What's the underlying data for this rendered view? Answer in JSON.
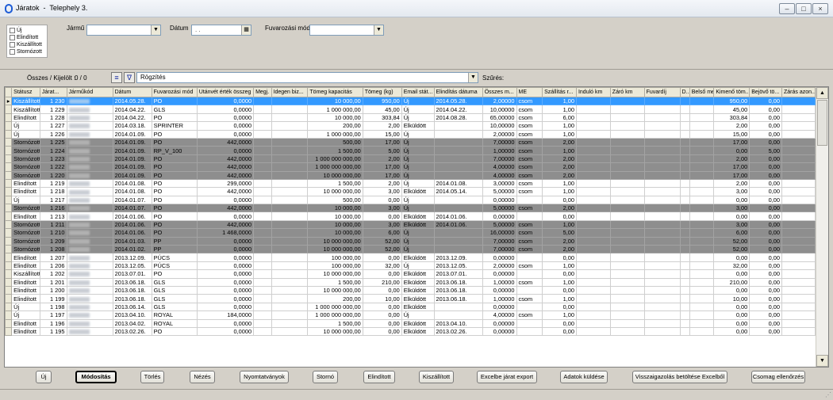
{
  "window": {
    "title": "Járatok  -  Telephely 3."
  },
  "filters": {
    "status_options": [
      "Új",
      "Elindított",
      "Kiszállított",
      "Stornózott"
    ],
    "jarmu_label": "Jármű",
    "datum_label": "Dátum",
    "datum_value": ". .",
    "fuvarozasi_mod_label": "Fuvarozási mód"
  },
  "info_bar": {
    "osszes_label": "Összes / Kijelölt :",
    "osszes_value": "0 / 0",
    "rogzites_value": "Rögzítés",
    "szures_label": "Szűrés:"
  },
  "table": {
    "columns": [
      "Státusz",
      "Járat...",
      "Járműkód",
      "Dátum",
      "Fuvarozási mód",
      "Utánvét érték összeg",
      "Megj.",
      "Idegen biz...",
      "Tömeg kapacitás",
      "Tömeg (kg)",
      "Email stát...",
      "Elindítás dátuma",
      "Összes m...",
      "ME",
      "Szállítás r...",
      "Induló km",
      "Záró km",
      "Fuvardíj",
      "D...",
      "Belső me...",
      "Kimenő töm...",
      "Bejövő tö...",
      "Zárás azon..."
    ],
    "rows": [
      {
        "status": "Kiszállított",
        "jarat": "1 230",
        "datum": "2014.05.28.",
        "mod": "PO",
        "utanvet": "0,0000",
        "kapacitas": "10 000,00",
        "tomeg": "950,00",
        "email": "Új",
        "elindit": "2014.05.28.",
        "osszes": "2,00000",
        "me": "csom",
        "szall": "1,00",
        "kimeno": "950,00",
        "bejovo": "0,00",
        "hl": "selected"
      },
      {
        "status": "Kiszállított",
        "jarat": "1 229",
        "datum": "2014.04.22.",
        "mod": "GLS",
        "utanvet": "0,0000",
        "kapacitas": "1 000 000,00",
        "tomeg": "45,00",
        "email": "Új",
        "elindit": "2014.04.22.",
        "osszes": "10,00000",
        "me": "csom",
        "szall": "1,00",
        "kimeno": "45,00",
        "bejovo": "0,00",
        "hl": ""
      },
      {
        "status": "Elindított",
        "jarat": "1 228",
        "datum": "2014.04.22.",
        "mod": "PO",
        "utanvet": "0,0000",
        "kapacitas": "10 000,00",
        "tomeg": "303,84",
        "email": "Új",
        "elindit": "2014.08.28.",
        "osszes": "65,00000",
        "me": "csom",
        "szall": "6,00",
        "kimeno": "303,84",
        "bejovo": "0,00",
        "hl": ""
      },
      {
        "status": "Új",
        "jarat": "1 227",
        "datum": "2014.03.18.",
        "mod": "SPRINTER",
        "utanvet": "0,0000",
        "kapacitas": "200,00",
        "tomeg": "2,00",
        "email": "Elküldött",
        "elindit": "",
        "osszes": "10,00000",
        "me": "csom",
        "szall": "1,00",
        "kimeno": "2,00",
        "bejovo": "0,00",
        "hl": ""
      },
      {
        "status": "Új",
        "jarat": "1 226",
        "datum": "2014.01.09.",
        "mod": "PO",
        "utanvet": "0,0000",
        "kapacitas": "1 000 000,00",
        "tomeg": "15,00",
        "email": "Új",
        "elindit": "",
        "osszes": "2,00000",
        "me": "csom",
        "szall": "1,00",
        "kimeno": "15,00",
        "bejovo": "0,00",
        "hl": ""
      },
      {
        "status": "Stornózott",
        "jarat": "1 225",
        "datum": "2014.01.09.",
        "mod": "PO",
        "utanvet": "442,0000",
        "kapacitas": "500,00",
        "tomeg": "17,00",
        "email": "Új",
        "elindit": "",
        "osszes": "7,00000",
        "me": "csom",
        "szall": "2,00",
        "kimeno": "17,00",
        "bejovo": "0,00",
        "hl": "storno"
      },
      {
        "status": "Stornózott",
        "jarat": "1 224",
        "datum": "2014.01.09.",
        "mod": "RP_V_100",
        "utanvet": "0,0000",
        "kapacitas": "1 500,00",
        "tomeg": "5,00",
        "email": "Új",
        "elindit": "",
        "osszes": "1,00000",
        "me": "csom",
        "szall": "1,00",
        "kimeno": "0,00",
        "bejovo": "5,00",
        "hl": "storno"
      },
      {
        "status": "Stornózott",
        "jarat": "1 223",
        "datum": "2014.01.09.",
        "mod": "PO",
        "utanvet": "442,0000",
        "kapacitas": "1 000 000 000,00",
        "tomeg": "2,00",
        "email": "Új",
        "elindit": "",
        "osszes": "7,00000",
        "me": "csom",
        "szall": "2,00",
        "kimeno": "2,00",
        "bejovo": "0,00",
        "hl": "storno"
      },
      {
        "status": "Stornózott",
        "jarat": "1 222",
        "datum": "2014.01.09.",
        "mod": "PO",
        "utanvet": "442,0000",
        "kapacitas": "1 000 000 000,00",
        "tomeg": "17,00",
        "email": "Új",
        "elindit": "",
        "osszes": "4,00000",
        "me": "csom",
        "szall": "2,00",
        "kimeno": "17,00",
        "bejovo": "0,00",
        "hl": "storno"
      },
      {
        "status": "Stornózott",
        "jarat": "1 220",
        "datum": "2014.01.09.",
        "mod": "PO",
        "utanvet": "442,0000",
        "kapacitas": "10 000 000,00",
        "tomeg": "17,00",
        "email": "Új",
        "elindit": "",
        "osszes": "4,00000",
        "me": "csom",
        "szall": "2,00",
        "kimeno": "17,00",
        "bejovo": "0,00",
        "hl": "storno"
      },
      {
        "status": "Elindított",
        "jarat": "1 219",
        "datum": "2014.01.08.",
        "mod": "PO",
        "utanvet": "299,0000",
        "kapacitas": "1 500,00",
        "tomeg": "2,00",
        "email": "Új",
        "elindit": "2014.01.08.",
        "osszes": "3,00000",
        "me": "csom",
        "szall": "1,00",
        "kimeno": "2,00",
        "bejovo": "0,00",
        "hl": ""
      },
      {
        "status": "Elindított",
        "jarat": "1 218",
        "datum": "2014.01.08.",
        "mod": "PO",
        "utanvet": "442,0000",
        "kapacitas": "10 000 000,00",
        "tomeg": "3,00",
        "email": "Elküldött",
        "elindit": "2014.05.14.",
        "osszes": "5,00000",
        "me": "csom",
        "szall": "1,00",
        "kimeno": "3,00",
        "bejovo": "0,00",
        "hl": ""
      },
      {
        "status": "Új",
        "jarat": "1 217",
        "datum": "2014.01.07.",
        "mod": "PO",
        "utanvet": "0,0000",
        "kapacitas": "500,00",
        "tomeg": "0,00",
        "email": "Új",
        "elindit": "",
        "osszes": "0,00000",
        "me": "",
        "szall": "0,00",
        "kimeno": "0,00",
        "bejovo": "0,00",
        "hl": ""
      },
      {
        "status": "Stornózott",
        "jarat": "1 216",
        "datum": "2014.01.07.",
        "mod": "PO",
        "utanvet": "442,0000",
        "kapacitas": "10 000,00",
        "tomeg": "3,00",
        "email": "Új",
        "elindit": "",
        "osszes": "5,00000",
        "me": "csom",
        "szall": "2,00",
        "kimeno": "3,00",
        "bejovo": "0,00",
        "hl": "storno"
      },
      {
        "status": "Elindított",
        "jarat": "1 213",
        "datum": "2014.01.06.",
        "mod": "PO",
        "utanvet": "0,0000",
        "kapacitas": "10 000,00",
        "tomeg": "0,00",
        "email": "Elküldött",
        "elindit": "2014.01.06.",
        "osszes": "0,00000",
        "me": "",
        "szall": "0,00",
        "kimeno": "0,00",
        "bejovo": "0,00",
        "hl": ""
      },
      {
        "status": "Stornózott",
        "jarat": "1 211",
        "datum": "2014.01.06.",
        "mod": "PO",
        "utanvet": "442,0000",
        "kapacitas": "10 000,00",
        "tomeg": "3,00",
        "email": "Elküldött",
        "elindit": "2014.01.06.",
        "osszes": "5,00000",
        "me": "csom",
        "szall": "1,00",
        "kimeno": "3,00",
        "bejovo": "0,00",
        "hl": "storno"
      },
      {
        "status": "Stornózott",
        "jarat": "1 210",
        "datum": "2014.01.06.",
        "mod": "PO",
        "utanvet": "1 468,0000",
        "kapacitas": "10 000,00",
        "tomeg": "6,00",
        "email": "Új",
        "elindit": "",
        "osszes": "16,00000",
        "me": "csom",
        "szall": "5,00",
        "kimeno": "6,00",
        "bejovo": "0,00",
        "hl": "storno"
      },
      {
        "status": "Stornózott",
        "jarat": "1 209",
        "datum": "2014.01.03.",
        "mod": "PP",
        "utanvet": "0,0000",
        "kapacitas": "10 000 000,00",
        "tomeg": "52,00",
        "email": "Új",
        "elindit": "",
        "osszes": "7,00000",
        "me": "csom",
        "szall": "2,00",
        "kimeno": "52,00",
        "bejovo": "0,00",
        "hl": "storno"
      },
      {
        "status": "Stornózott",
        "jarat": "1 208",
        "datum": "2014.01.02.",
        "mod": "PP",
        "utanvet": "0,0000",
        "kapacitas": "10 000 000,00",
        "tomeg": "52,00",
        "email": "Új",
        "elindit": "",
        "osszes": "7,00000",
        "me": "csom",
        "szall": "2,00",
        "kimeno": "52,00",
        "bejovo": "0,00",
        "hl": "storno"
      },
      {
        "status": "Elindított",
        "jarat": "1 207",
        "datum": "2013.12.09.",
        "mod": "PÚCS",
        "utanvet": "0,0000",
        "kapacitas": "100 000,00",
        "tomeg": "0,00",
        "email": "Elküldött",
        "elindit": "2013.12.09.",
        "osszes": "0,00000",
        "me": "",
        "szall": "0,00",
        "kimeno": "0,00",
        "bejovo": "0,00",
        "hl": ""
      },
      {
        "status": "Elindított",
        "jarat": "1 206",
        "datum": "2013.12.05.",
        "mod": "PÚCS",
        "utanvet": "0,0000",
        "kapacitas": "100 000,00",
        "tomeg": "32,00",
        "email": "Új",
        "elindit": "2013.12.05.",
        "osszes": "2,00000",
        "me": "csom",
        "szall": "1,00",
        "kimeno": "32,00",
        "bejovo": "0,00",
        "hl": ""
      },
      {
        "status": "Kiszállított",
        "jarat": "1 202",
        "datum": "2013.07.01.",
        "mod": "PO",
        "utanvet": "0,0000",
        "kapacitas": "10 000 000,00",
        "tomeg": "0,00",
        "email": "Elküldött",
        "elindit": "2013.07.01.",
        "osszes": "0,00000",
        "me": "",
        "szall": "0,00",
        "kimeno": "0,00",
        "bejovo": "0,00",
        "hl": ""
      },
      {
        "status": "Elindított",
        "jarat": "1 201",
        "datum": "2013.06.18.",
        "mod": "GLS",
        "utanvet": "0,0000",
        "kapacitas": "1 500,00",
        "tomeg": "210,00",
        "email": "Elküldött",
        "elindit": "2013.06.18.",
        "osszes": "1,00000",
        "me": "csom",
        "szall": "1,00",
        "kimeno": "210,00",
        "bejovo": "0,00",
        "hl": ""
      },
      {
        "status": "Elindított",
        "jarat": "1 200",
        "datum": "2013.06.18.",
        "mod": "GLS",
        "utanvet": "0,0000",
        "kapacitas": "10 000 000,00",
        "tomeg": "0,00",
        "email": "Elküldött",
        "elindit": "2013.06.18.",
        "osszes": "0,00000",
        "me": "",
        "szall": "0,00",
        "kimeno": "0,00",
        "bejovo": "0,00",
        "hl": ""
      },
      {
        "status": "Elindított",
        "jarat": "1 199",
        "datum": "2013.06.18.",
        "mod": "GLS",
        "utanvet": "0,0000",
        "kapacitas": "200,00",
        "tomeg": "10,00",
        "email": "Elküldött",
        "elindit": "2013.06.18.",
        "osszes": "1,00000",
        "me": "csom",
        "szall": "1,00",
        "kimeno": "10,00",
        "bejovo": "0,00",
        "hl": ""
      },
      {
        "status": "Új",
        "jarat": "1 198",
        "datum": "2013.06.14.",
        "mod": "GLS",
        "utanvet": "0,0000",
        "kapacitas": "1 000 000 000,00",
        "tomeg": "0,00",
        "email": "Elküldött",
        "elindit": "",
        "osszes": "0,00000",
        "me": "",
        "szall": "0,00",
        "kimeno": "0,00",
        "bejovo": "0,00",
        "hl": ""
      },
      {
        "status": "Új",
        "jarat": "1 197",
        "datum": "2013.04.10.",
        "mod": "ROYAL",
        "utanvet": "184,0000",
        "kapacitas": "1 000 000 000,00",
        "tomeg": "0,00",
        "email": "Új",
        "elindit": "",
        "osszes": "4,00000",
        "me": "csom",
        "szall": "1,00",
        "kimeno": "0,00",
        "bejovo": "0,00",
        "hl": ""
      },
      {
        "status": "Elindított",
        "jarat": "1 196",
        "datum": "2013.04.02.",
        "mod": "ROYAL",
        "utanvet": "0,0000",
        "kapacitas": "1 500,00",
        "tomeg": "0,00",
        "email": "Elküldött",
        "elindit": "2013.04.10.",
        "osszes": "0,00000",
        "me": "",
        "szall": "0,00",
        "kimeno": "0,00",
        "bejovo": "0,00",
        "hl": ""
      },
      {
        "status": "Elindított",
        "jarat": "1 195",
        "datum": "2013.02.26.",
        "mod": "PO",
        "utanvet": "0,0000",
        "kapacitas": "10 000 000,00",
        "tomeg": "0,00",
        "email": "Elküldött",
        "elindit": "2013.02.26.",
        "osszes": "0,00000",
        "me": "",
        "szall": "0,00",
        "kimeno": "0,00",
        "bejovo": "0,00",
        "hl": ""
      }
    ]
  },
  "buttons": [
    "Új",
    "Módosítás",
    "Törlés",
    "Nézés",
    "Nyomtatványok",
    "Stornó",
    "Elindított",
    "Kiszállított",
    "Excelbe járat export",
    "Adatok küldése",
    "Visszaigazolás betöltése Excelből",
    "Csomag ellenőrzés"
  ],
  "icons": {
    "app": "app-icon",
    "minimize": "minimize-icon",
    "maximize": "maximize-icon",
    "close": "close-icon",
    "list": "list-view-icon",
    "filter": "filter-icon",
    "calendar": "calendar-icon"
  },
  "colors": {
    "selected_row": "#3399ff",
    "storno_row": "#8e8e8e",
    "app_icon": "#1c5bd6"
  }
}
